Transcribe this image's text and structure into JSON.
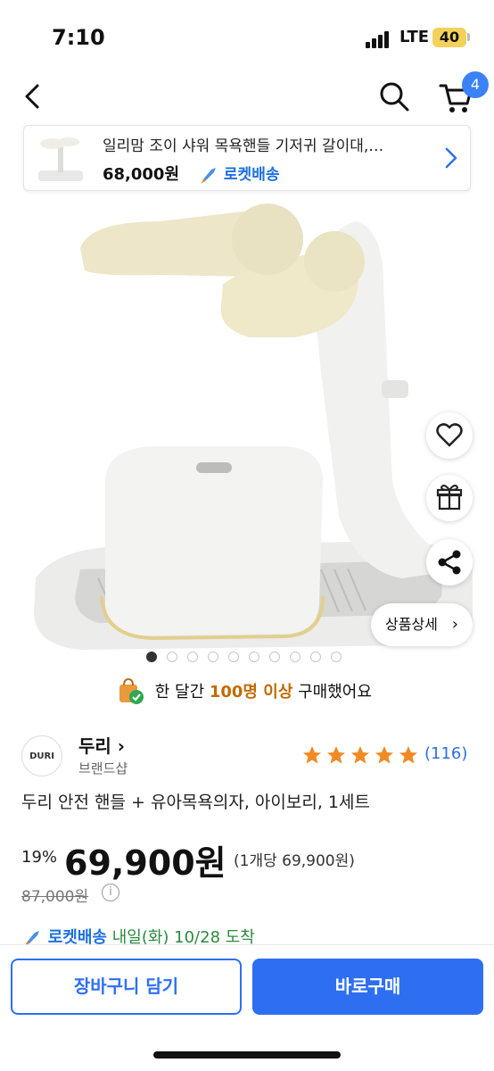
{
  "status": {
    "time": "7:10",
    "network": "LTE",
    "battery": "40"
  },
  "nav": {
    "cart_count": "4"
  },
  "recent": {
    "title": "일리맘 조이 샤워 목욕핸들 기저귀 갈이대,…",
    "price": "68,000원",
    "delivery": "로켓배송"
  },
  "gallery": {
    "total": 10,
    "active": 1,
    "detail_label": "상품상세"
  },
  "purchase_note": {
    "prefix": "한 달간 ",
    "highlight": "100명 이상",
    "suffix": " 구매했어요"
  },
  "brand": {
    "logo_text": "DURI",
    "name": "두리 ",
    "chevron": "›",
    "subtitle": "브랜드샵"
  },
  "rating": {
    "stars": 5,
    "count": "(116)"
  },
  "product": {
    "title": "두리 안전 핸들 + 유아목욕의자, 아이보리, 1세트",
    "discount": "19%",
    "price": "69,900원",
    "unit_price": "(1개당 69,900원)",
    "original_price": "87,000원",
    "info_symbol": "i"
  },
  "delivery": {
    "badge": "로켓배송",
    "eta": " 내일(화) 10/28 도착"
  },
  "actions": {
    "add_to_cart": "장바구니 담기",
    "buy_now": "바로구매"
  },
  "colors": {
    "accent": "#2e6ff2",
    "star": "#f08a24",
    "rocket_blue": "#1d6fe0",
    "arrive_green": "#2b8a3e"
  },
  "icons": [
    "back-icon",
    "search-icon",
    "cart-icon",
    "heart-icon",
    "gift-icon",
    "share-icon",
    "info-icon",
    "shopping-bag-icon",
    "rocket-icon",
    "star-icon"
  ]
}
